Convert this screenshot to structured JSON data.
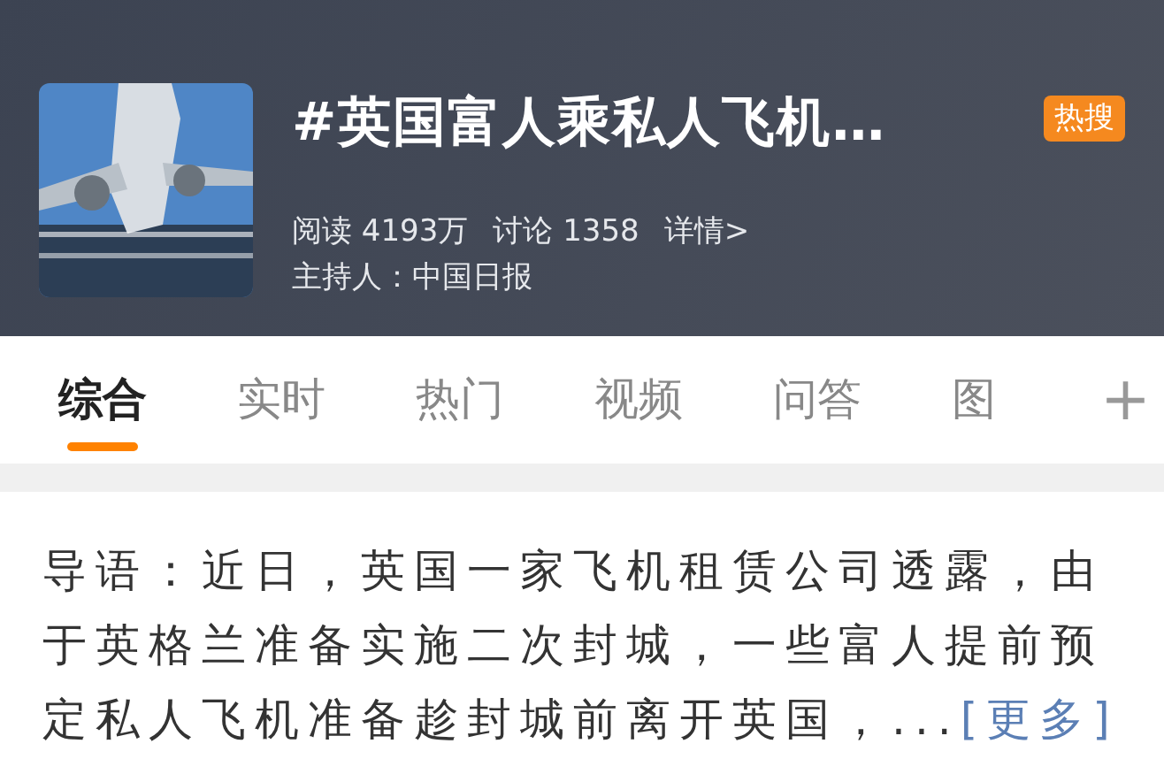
{
  "header": {
    "title": "#英国富人乘私人飞机…",
    "badge": "热搜",
    "stats": [
      {
        "label": "阅读",
        "value": "4193万"
      },
      {
        "label": "讨论",
        "value": "1358"
      }
    ],
    "details_link": "详情>",
    "host": "主持人：中国日报"
  },
  "tabs": [
    {
      "label": "综合",
      "selected": true
    },
    {
      "label": "实时",
      "selected": false
    },
    {
      "label": "热门",
      "selected": false
    },
    {
      "label": "视频",
      "selected": false
    },
    {
      "label": "问答",
      "selected": false
    },
    {
      "label": "图",
      "selected": false
    }
  ],
  "add_tab": "+",
  "intro": {
    "text": "导语：近日，英国一家飞机租赁公司透露，由于英格兰准备实施二次封城，一些富人提前预定私人飞机准备趁封城前离开英国，...",
    "more_link": "[更多]"
  }
}
